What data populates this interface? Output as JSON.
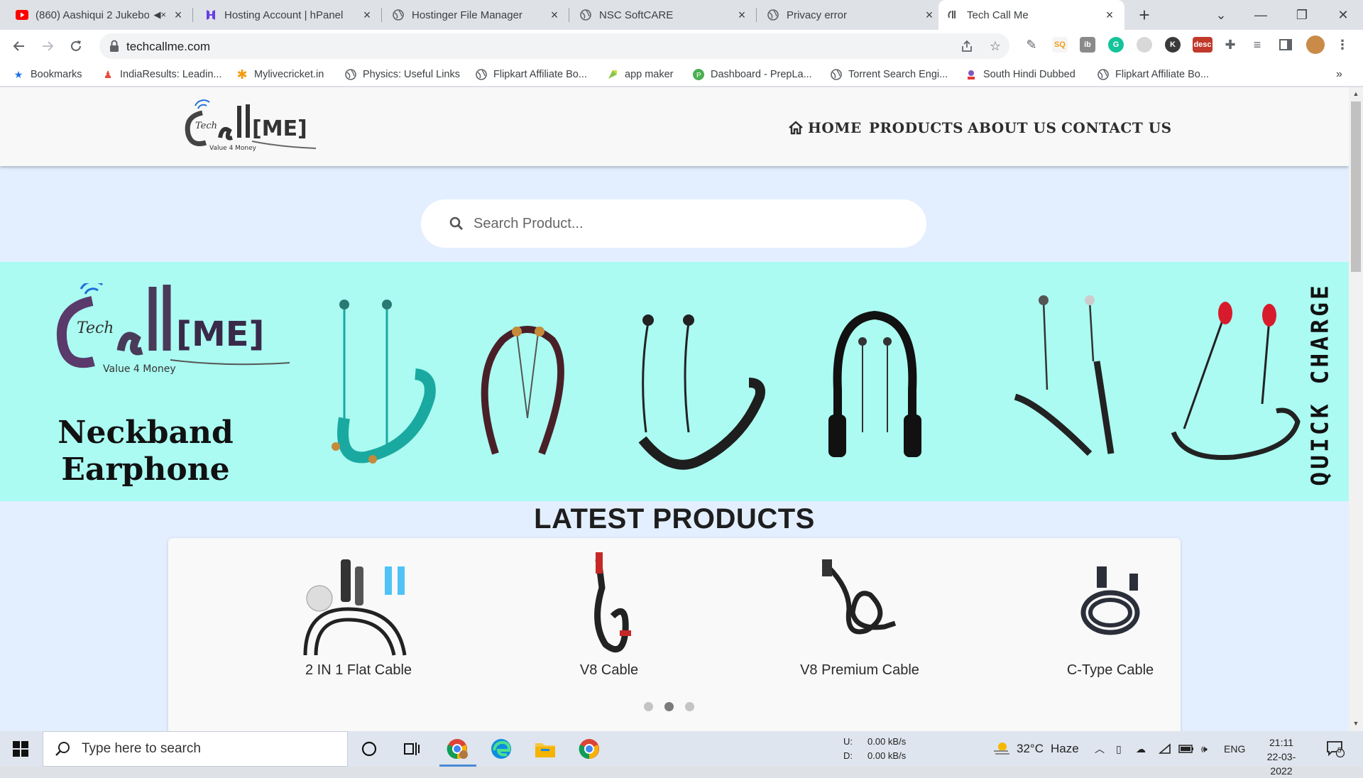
{
  "browser": {
    "tabs": [
      {
        "title": "(860) Aashiqui 2 Jukebo",
        "icon": "youtube-icon"
      },
      {
        "title": "Hosting Account | hPanel",
        "icon": "hostinger-icon"
      },
      {
        "title": "Hostinger File Manager",
        "icon": "globe-icon"
      },
      {
        "title": "NSC SoftCARE",
        "icon": "globe-icon"
      },
      {
        "title": "Privacy error",
        "icon": "globe-icon"
      },
      {
        "title": "Tech Call Me",
        "icon": "techcallme-icon",
        "active": true
      }
    ],
    "url": "techcallme.com",
    "bookmarks": [
      {
        "label": "Bookmarks",
        "icon": "star-icon"
      },
      {
        "label": "IndiaResults: Leadin...",
        "icon": "indiaresults-icon"
      },
      {
        "label": "Mylivecricket.in",
        "icon": "asterisk-icon"
      },
      {
        "label": "Physics: Useful Links",
        "icon": "globe-icon"
      },
      {
        "label": "Flipkart Affiliate Bo...",
        "icon": "globe-icon"
      },
      {
        "label": "app maker",
        "icon": "appmaker-icon"
      },
      {
        "label": "Dashboard - PrepLa...",
        "icon": "preplane-icon"
      },
      {
        "label": "Torrent Search Engi...",
        "icon": "globe-icon"
      },
      {
        "label": "South Hindi Dubbed",
        "icon": "southhindi-icon"
      },
      {
        "label": "Flipkart Affiliate Bo...",
        "icon": "globe-icon"
      }
    ]
  },
  "site": {
    "nav": {
      "home": "HOME",
      "products": "PRODUCTS",
      "about": "ABOUT US",
      "contact": "CONTACT US"
    },
    "search": {
      "placeholder": "Search Product..."
    },
    "banner": {
      "title_line1": "Neckband",
      "title_line2": "Earphone",
      "side_text": "QUICK CHARGE"
    },
    "latest": {
      "title": "LATEST PRODUCTS",
      "products": [
        {
          "name": "2 IN 1 Flat Cable"
        },
        {
          "name": "V8 Cable"
        },
        {
          "name": "V8 Premium Cable"
        },
        {
          "name": "C-Type Cable"
        }
      ],
      "carousel_dots": 3,
      "active_dot": 1
    }
  },
  "taskbar": {
    "search_placeholder": "Type here to search",
    "net_up_label": "U:",
    "net_up": "0.00 kB/s",
    "net_down_label": "D:",
    "net_down": "0.00 kB/s",
    "weather_temp": "32°C",
    "weather_desc": "Haze",
    "language": "ENG",
    "time": "21:11",
    "date": "22-03-2022",
    "notification_count": "5"
  },
  "colors": {
    "banner_bg": "#abfbf2",
    "page_bg": "#e3efff",
    "header_bg": "#f8f8f8"
  }
}
